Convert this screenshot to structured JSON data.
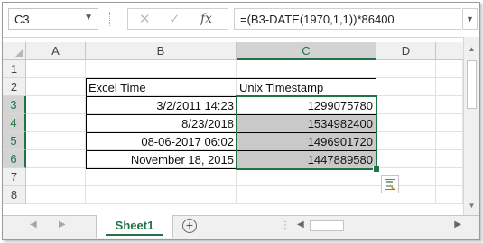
{
  "formula_bar": {
    "name_box": "C3",
    "cancel_symbol": "✕",
    "enter_symbol": "✓",
    "fx_symbol": "fx",
    "formula": "=(B3-DATE(1970,1,1))*86400"
  },
  "columns": [
    "A",
    "B",
    "C",
    "D"
  ],
  "rows": [
    "1",
    "2",
    "3",
    "4",
    "5",
    "6",
    "7",
    "8"
  ],
  "table": {
    "header_b": "Excel Time",
    "header_c": "Unix Timestamp",
    "rows": [
      {
        "excel_time": "3/2/2011 14:23",
        "unix_timestamp": "1299075780"
      },
      {
        "excel_time": "8/23/2018",
        "unix_timestamp": "1534982400"
      },
      {
        "excel_time": "08-06-2017 06:02",
        "unix_timestamp": "1496901720"
      },
      {
        "excel_time": "November 18, 2015",
        "unix_timestamp": "1447889580"
      }
    ]
  },
  "sheet_tabs": [
    {
      "label": "Sheet1",
      "active": true
    }
  ],
  "icons": {
    "add_sheet": "plus-circle-icon",
    "quick_analysis": "quick-analysis-icon",
    "prev_sheet": "triangle-left-icon",
    "next_sheet": "triangle-right-icon"
  },
  "colors": {
    "accent": "#217346",
    "selection_fill": "#c9c9c9"
  }
}
